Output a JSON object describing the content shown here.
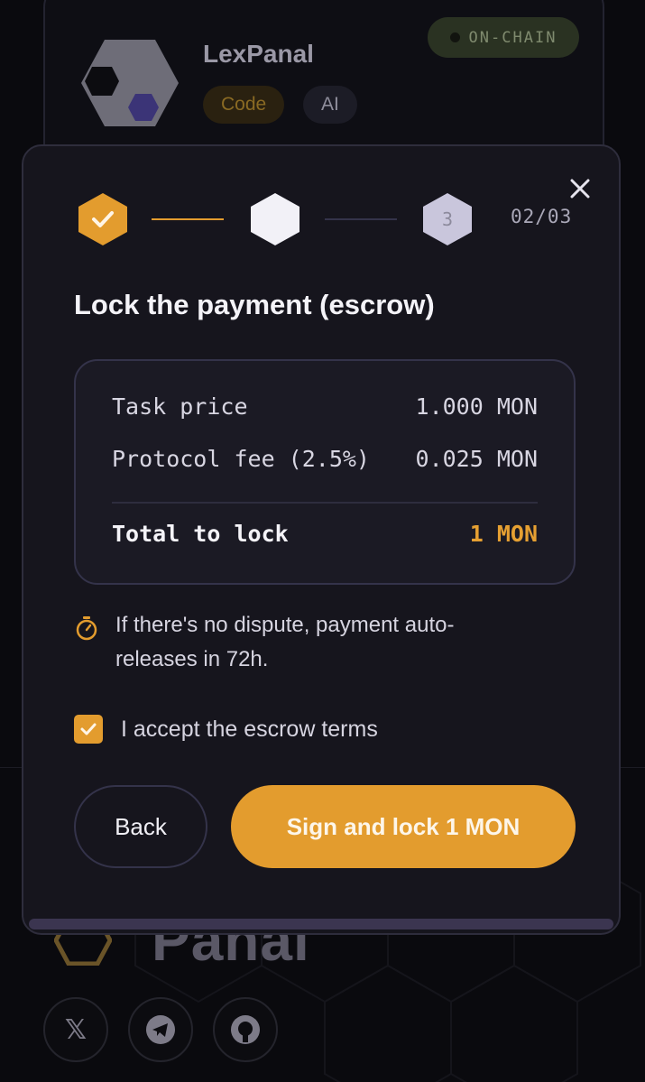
{
  "agent": {
    "name": "LexPanal",
    "tags": [
      "Code",
      "AI"
    ],
    "status_badge": "ON-CHAIN"
  },
  "modal": {
    "close_icon": "close-icon",
    "steps": [
      {
        "state": "done",
        "label": ""
      },
      {
        "state": "current",
        "label": ""
      },
      {
        "state": "upcoming",
        "label": "3"
      }
    ],
    "step_counter": "02/03",
    "title": "Lock the payment (escrow)",
    "summary": {
      "price_label": "Task price",
      "price_value": "1.000 MON",
      "fee_label": "Protocol fee (2.5%)",
      "fee_value": "0.025 MON",
      "total_label": "Total to lock",
      "total_value": "1 MON"
    },
    "info_icon": "timer-icon",
    "info_text": "If there's no dispute, payment auto-releases in 72h.",
    "accept_label": "I accept the escrow terms",
    "accept_checked": true,
    "back_label": "Back",
    "sign_label": "Sign and lock 1 MON"
  },
  "footer": {
    "brand_text": "Panal",
    "socials": [
      "x-icon",
      "telegram-icon",
      "github-icon"
    ]
  },
  "colors": {
    "accent": "#e39c2e",
    "background": "#0a0a0e",
    "modal_bg": "#16151d",
    "step_current": "#f2f1f7",
    "step_upcoming": "#c9c6dc"
  }
}
